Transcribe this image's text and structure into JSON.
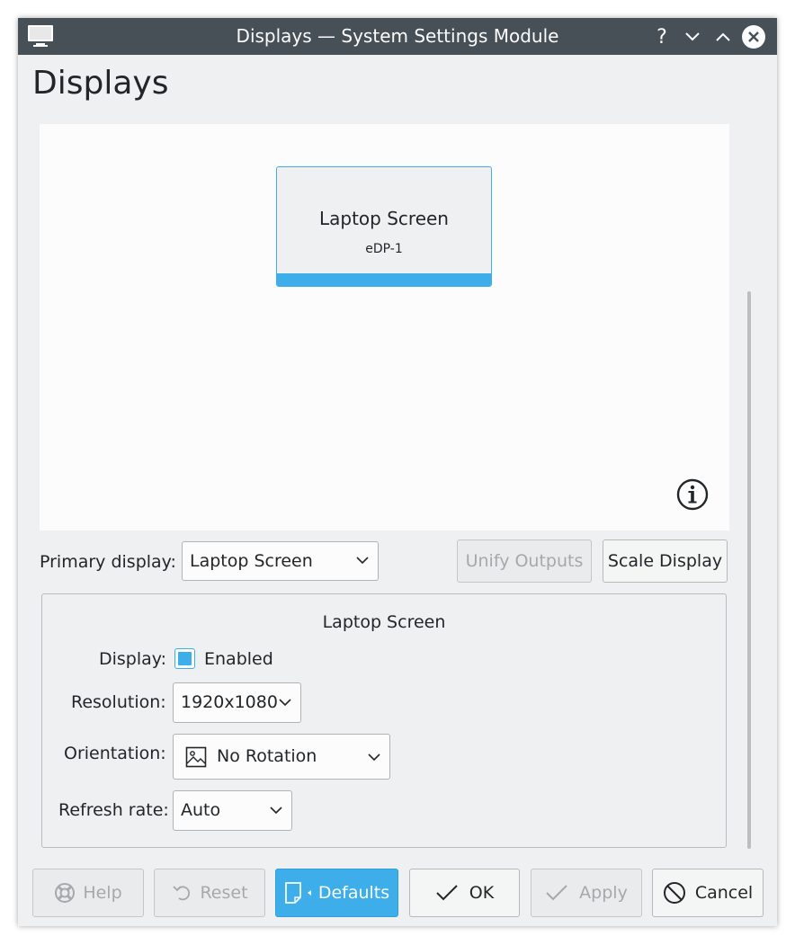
{
  "window": {
    "title": "Displays — System Settings Module",
    "icons": {
      "app": "monitor-icon",
      "help": "help-icon",
      "minimize": "chevron-down-icon",
      "maximize": "chevron-up-icon",
      "close": "close-icon"
    },
    "help_glyph": "?"
  },
  "page": {
    "title": "Displays"
  },
  "canvas": {
    "screen": {
      "name": "Laptop Screen",
      "connector": "eDP-1"
    },
    "info_icon": "info-icon"
  },
  "primary_display": {
    "label": "Primary display:",
    "value": "Laptop Screen"
  },
  "buttons": {
    "unify_outputs": "Unify Outputs",
    "scale_display": "Scale Display"
  },
  "output": {
    "title": "Laptop Screen",
    "display": {
      "label": "Display:",
      "checkbox_label": "Enabled",
      "checked": true
    },
    "resolution": {
      "label": "Resolution:",
      "value": "1920x1080"
    },
    "orientation": {
      "label": "Orientation:",
      "value": "No Rotation",
      "icon": "image-icon"
    },
    "refresh_rate": {
      "label": "Refresh rate:",
      "value": "Auto"
    }
  },
  "footer": {
    "help": {
      "label": "Help",
      "icon": "lifebuoy-icon"
    },
    "reset": {
      "label": "Reset",
      "icon": "undo-icon"
    },
    "defaults": {
      "label": "Defaults",
      "icon": "document-icon"
    },
    "ok": {
      "label": "OK",
      "icon": "check-icon"
    },
    "apply": {
      "label": "Apply",
      "icon": "check-icon"
    },
    "cancel": {
      "label": "Cancel",
      "icon": "cancel-icon"
    }
  },
  "colors": {
    "accent": "#3daee9",
    "titlebar": "#475057",
    "window_bg": "#eff0f1",
    "canvas_bg": "#fcfcfc"
  }
}
